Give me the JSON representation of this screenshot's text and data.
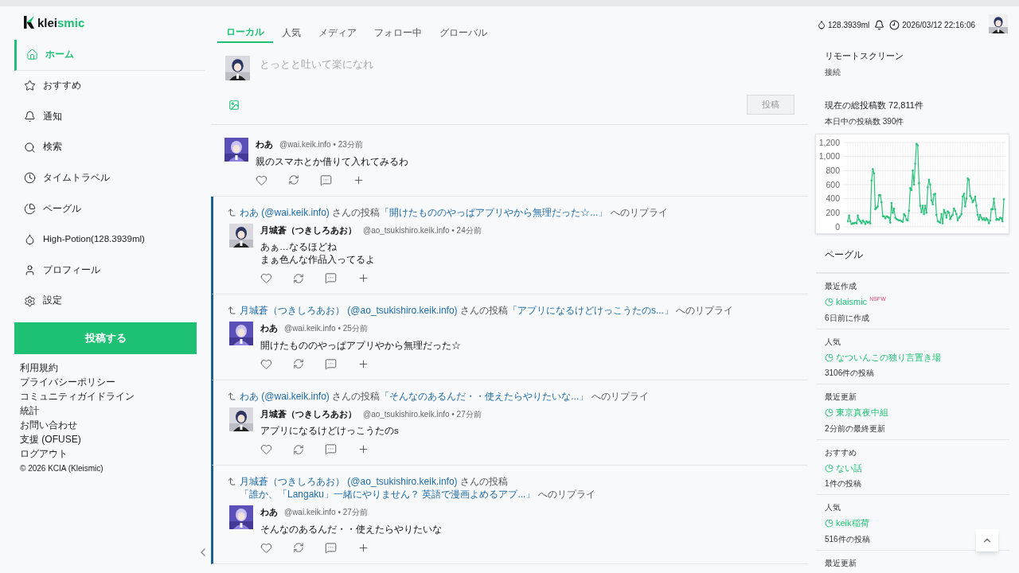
{
  "sidebar": {
    "logo": {
      "first": "klei",
      "second": "smic"
    },
    "nav": [
      {
        "label": "ホーム",
        "selected": true
      },
      {
        "label": "おすすめ",
        "selected": false
      },
      {
        "label": "通知",
        "selected": false
      },
      {
        "label": "検索",
        "selected": false
      },
      {
        "label": "タイムトラベル",
        "selected": false
      },
      {
        "label": "ペーグル",
        "selected": false
      },
      {
        "label": "High-Potion(128.3939ml)",
        "selected": false
      },
      {
        "label": "プロフィール",
        "selected": false
      },
      {
        "label": "設定",
        "selected": false
      }
    ],
    "post_button": "投稿する",
    "footer_links": [
      "利用規約",
      "プライバシーポリシー",
      "コミュニティガイドライン",
      "統計",
      "お問い合わせ",
      "支援 (OFUSE)",
      "ログアウト"
    ],
    "copyright": "© 2026 KCIA (Kleismic)"
  },
  "main": {
    "tabs": [
      {
        "label": "ローカル",
        "selected": true
      },
      {
        "label": "人気",
        "selected": false
      },
      {
        "label": "メディア",
        "selected": false
      },
      {
        "label": "フォロー中",
        "selected": false
      },
      {
        "label": "グローバル",
        "selected": false
      }
    ],
    "composer": {
      "placeholder": "とっとと吐いて楽になれ",
      "submit": "投稿",
      "submit_disabled": true
    },
    "posts": [
      {
        "name": "わあ",
        "meta": "@wai.keik.info • 23分前",
        "body": [
          "親のスマホとか借りて入れてみるわ"
        ]
      },
      {
        "reply": {
          "user": "わあ (@wai.keik.info)",
          "middle": "さんの投稿",
          "post": "「開けたもののやっぱアプリやから無理だった☆...」",
          "tail": "へのリプライ"
        },
        "name": "月城蒼（つきしろあお）",
        "meta": "@ao_tsukishiro.keik.info • 24分前",
        "body": [
          "あぁ…なるほどね",
          "まぁ色んな作品入ってるよ"
        ]
      },
      {
        "reply": {
          "user": "月城蒼（つきしろあお） (@ao_tsukishiro.keik.info)",
          "middle": "さんの投稿",
          "post": "「アプリになるけどけっこうたのs...」",
          "tail": "へのリプライ"
        },
        "name": "わあ",
        "meta": "@wai.keik.info • 25分前",
        "body": [
          "開けたもののやっぱアプリやから無理だった☆"
        ]
      },
      {
        "reply": {
          "user": "わあ (@wai.keik.info)",
          "middle": "さんの投稿",
          "post": "「そんなのあるんだ・・使えたらやりたいな...」",
          "tail": "へのリプライ"
        },
        "name": "月城蒼（つきしろあお）",
        "meta": "@ao_tsukishiro.keik.info • 27分前",
        "body": [
          "アプリになるけどけっこうたのs"
        ]
      },
      {
        "reply": {
          "user": "月城蒼（つきしろあお） (@ao_tsukishiro.keik.info)",
          "middle": "さんの投稿",
          "post": "「誰か、「Langaku」一緒にやりません？ 英語で漫画よめるアプ...」",
          "tail": "へのリプライ"
        },
        "name": "わあ",
        "meta": "@wai.keik.info • 27分前",
        "body": [
          "そんなのあるんだ・・使えたらやりたいな"
        ]
      }
    ]
  },
  "right": {
    "potion": "128.3939ml",
    "datetime": "2026/03/12 22:16:06",
    "remote": {
      "title": "リモートスクリーン",
      "status": "接続"
    },
    "stats": {
      "title": "現在の総投稿数 72,811件",
      "subtitle": "本日中の投稿数 390件",
      "chart_data": {
        "type": "line",
        "grid": true,
        "ylim": [
          0,
          1200
        ],
        "yticks": [
          {
            "value": 0,
            "label": "0"
          },
          {
            "value": 200,
            "label": "200"
          },
          {
            "value": 400,
            "label": "400"
          },
          {
            "value": 600,
            "label": "600"
          },
          {
            "value": 800,
            "label": "800"
          },
          {
            "value": 1000,
            "label": "1,000"
          },
          {
            "value": 1200,
            "label": "1,200"
          }
        ],
        "series": [
          {
            "color": "#2ec27e",
            "values": [
              80,
              160,
              80,
              40,
              50,
              50,
              60,
              50,
              160,
              100,
              80,
              50,
              90,
              70,
              40,
              80,
              60,
              70,
              50,
              660,
              820,
              760,
              250,
              270,
              290,
              450,
              450,
              350,
              150,
              150,
              120,
              150,
              140,
              130,
              60,
              340,
              200,
              260,
              130,
              110,
              100,
              90,
              90,
              80,
              70,
              180,
              160,
              100,
              90,
              230,
              550,
              520,
              800,
              600,
              900,
              1180,
              1160,
              620,
              300,
              210,
              300,
              180,
              300,
              200,
              560,
              670,
              600,
              380,
              320,
              460,
              470,
              170,
              80,
              70,
              60,
              180,
              50,
              240,
              200,
              130,
              220,
              200,
              110,
              150,
              170,
              260,
              230,
              180,
              90,
              130,
              150,
              180,
              430,
              470,
              290,
              400,
              690,
              670,
              440,
              410,
              350,
              380,
              430,
              300,
              170,
              100,
              170,
              130,
              100,
              120,
              90,
              120,
              100,
              50,
              90,
              250,
              250,
              400,
              250,
              100,
              110,
              100,
              130,
              120,
              80,
              390
            ]
          }
        ]
      }
    },
    "pagegull": {
      "title": "ペーグル",
      "items": [
        {
          "category": "最近作成",
          "name": "klaismic",
          "badge": "NSFW",
          "detail": "6日前に作成"
        },
        {
          "category": "人気",
          "name": "なついんこの独り言置き場",
          "detail": "3106件の投稿"
        },
        {
          "category": "最近更新",
          "name": "東京真夜中組",
          "detail": "2分前の最終更新"
        },
        {
          "category": "おすすめ",
          "name": "ない話",
          "detail": "1件の投稿"
        },
        {
          "category": "人気",
          "name": "keik稲荷",
          "detail": "516件の投稿"
        },
        {
          "category": "最近更新"
        }
      ]
    }
  }
}
